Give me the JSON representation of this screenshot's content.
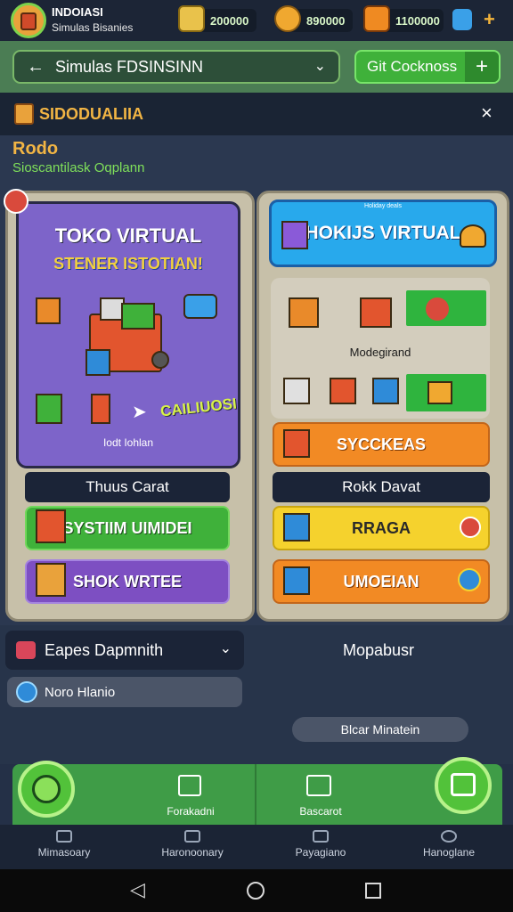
{
  "header": {
    "title": "INDOIASI",
    "subtitle": "Simulas Bisanies",
    "resources": [
      {
        "value": "200000",
        "icon": "cube-icon",
        "color": "#e9c24b"
      },
      {
        "value": "890000",
        "icon": "coin-icon",
        "color": "#f0a830"
      },
      {
        "value": "1100000",
        "icon": "crate-icon",
        "color": "#ef8a22"
      }
    ],
    "extra_icon": "chat-icon",
    "add_label": "+"
  },
  "nav": {
    "back_icon": "arrow-left-icon",
    "selector_label": "Simulas FDSINSINN",
    "button_label": "Git Cocknoss",
    "button_plus": "+"
  },
  "panel": {
    "title": "SIDODUALIIA",
    "close_label": "×",
    "heading": "Rodo",
    "subheading": "Sioscantilask Oqplann"
  },
  "left_card": {
    "title": "TOKO VIRTUAL",
    "subtitle": "STENER ISTOTIAN!",
    "overlay_text": "CAILIUOSI",
    "caption": "Iodt Iohlan",
    "section_label": "Thuus Carat",
    "btn_primary": "SYSTIIM UIMIDEI",
    "btn_secondary": "SHOK WRTEE"
  },
  "right_card": {
    "top_caption": "Holiday deals",
    "title": "HOKIJS VIRTUAL",
    "mod_label": "Modegirand",
    "btn_orange": "SYCCKEAS",
    "section_label": "Rokk Davat",
    "btn_yellow": "RRAGA",
    "btn_orange2": "UMOEIAN"
  },
  "lower": {
    "dropdown_label": "Eapes Dapmnith",
    "field_label": "Noro Hlanio",
    "right_title": "Mopabusr",
    "pill_label": "Blcar Minatein"
  },
  "actions": {
    "item1": "Forakadni",
    "item2": "Bascarot"
  },
  "tabs": [
    "Mimasoary",
    "Haronoonary",
    "Payagiano",
    "Hanoglane"
  ]
}
